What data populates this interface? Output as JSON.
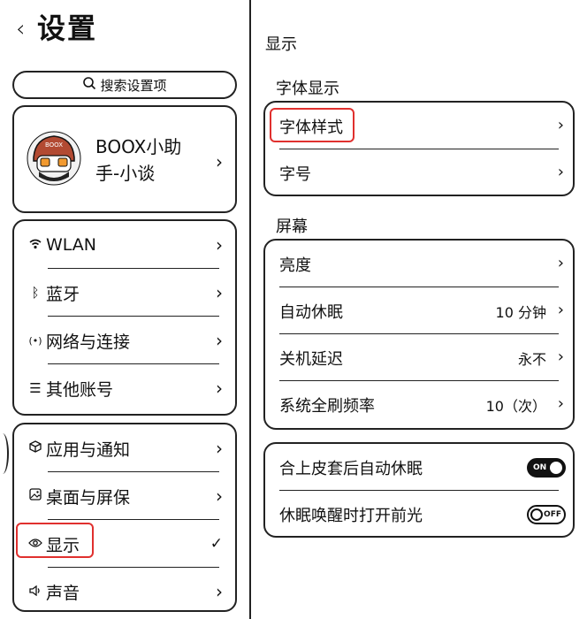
{
  "header": {
    "back_icon": "chevron-left-icon",
    "title": "设置"
  },
  "search": {
    "icon": "search-icon",
    "label": "搜索设置项"
  },
  "user": {
    "name": "BOOX小助手-小谈",
    "name_line1": "BOOX小助",
    "name_line2": "手-小谈",
    "avatar_text": "BOOX"
  },
  "groups": [
    {
      "items": [
        {
          "icon": "wifi-icon",
          "label": "WLAN"
        },
        {
          "icon": "bluetooth-icon",
          "label": "蓝牙"
        },
        {
          "icon": "network-icon",
          "label": "网络与连接"
        },
        {
          "icon": "accounts-icon",
          "label": "其他账号"
        }
      ]
    },
    {
      "items": [
        {
          "icon": "apps-icon",
          "label": "应用与通知"
        },
        {
          "icon": "wallpaper-icon",
          "label": "桌面与屏保"
        },
        {
          "icon": "eye-icon",
          "label": "显示",
          "selected": true
        },
        {
          "icon": "speaker-icon",
          "label": "声音"
        }
      ]
    }
  ],
  "right": {
    "page_title": "显示",
    "font_section": {
      "title": "字体显示",
      "items": [
        {
          "label": "字体样式"
        },
        {
          "label": "字号"
        }
      ]
    },
    "screen_section": {
      "title": "屏幕",
      "items": [
        {
          "label": "亮度",
          "value": ""
        },
        {
          "label": "自动休眠",
          "value": "10 分钟"
        },
        {
          "label": "关机延迟",
          "value": "永不"
        },
        {
          "label": "系统全刷频率",
          "value": "10（次）"
        }
      ]
    },
    "toggles": [
      {
        "label": "合上皮套后自动休眠",
        "state": "ON"
      },
      {
        "label": "休眠唤醒时打开前光",
        "state": "OFF"
      }
    ]
  },
  "colors": {
    "highlight": "#e0302e",
    "ink": "#111111"
  }
}
